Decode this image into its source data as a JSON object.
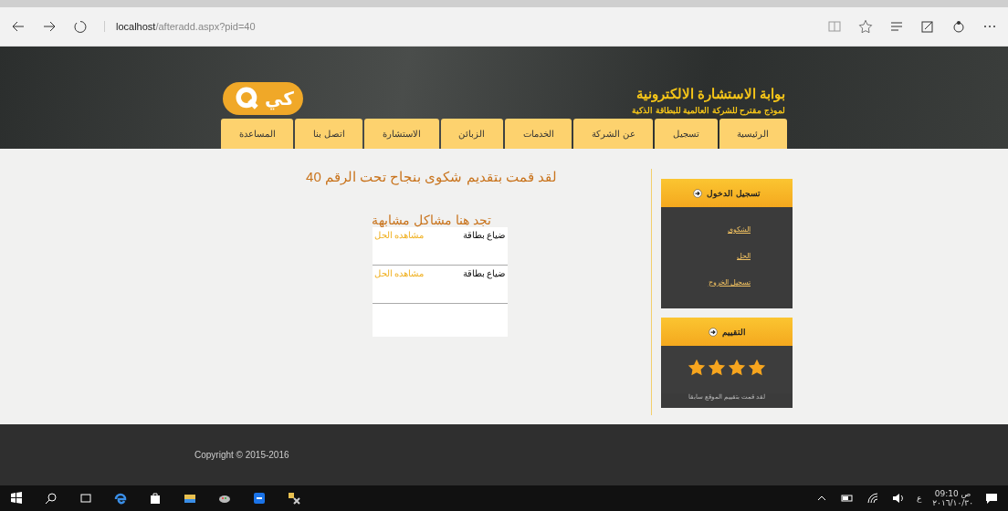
{
  "browser": {
    "url_host": "localhost",
    "url_path": "/afteradd.aspx?pid=40"
  },
  "header": {
    "title": "بوابة الاستشارة الالكترونية",
    "subtitle": "لموذج مقترح للشركة العالمية للبطاقة الذكية",
    "logo_text": "كي"
  },
  "nav": [
    {
      "label": "الرئيسية"
    },
    {
      "label": "تسجيل"
    },
    {
      "label": "عن الشركة"
    },
    {
      "label": "الخدمات"
    },
    {
      "label": "الزبائن"
    },
    {
      "label": "الاستشارة"
    },
    {
      "label": "اتصل بنا"
    },
    {
      "label": "المساعدة"
    }
  ],
  "sidebar": {
    "login_panel": {
      "title": "تسجيل الدخول",
      "links": [
        "الشكوى",
        "الحل",
        "تسجيل الخروج"
      ]
    },
    "rating_panel": {
      "title": "التقييم",
      "stars": 4,
      "note": "لقد قمت بتقييم الموقع سابقا"
    }
  },
  "main": {
    "message": "لقد قمت بتقديم شكوى بنجاح تحت الرقم 40",
    "similar_title": "تجد هنا مشاكل مشابهة",
    "problems": [
      {
        "title": "ضياع بطاقة",
        "link": "مشاهده الحل"
      },
      {
        "title": "ضياع بطاقة",
        "link": "مشاهده الحل"
      }
    ]
  },
  "footer": {
    "copyright": "Copyright © 2015-2016"
  },
  "taskbar": {
    "language": "ع",
    "time": "09:10 ص",
    "date": "٢٠١٦/١٠/٣٠"
  }
}
